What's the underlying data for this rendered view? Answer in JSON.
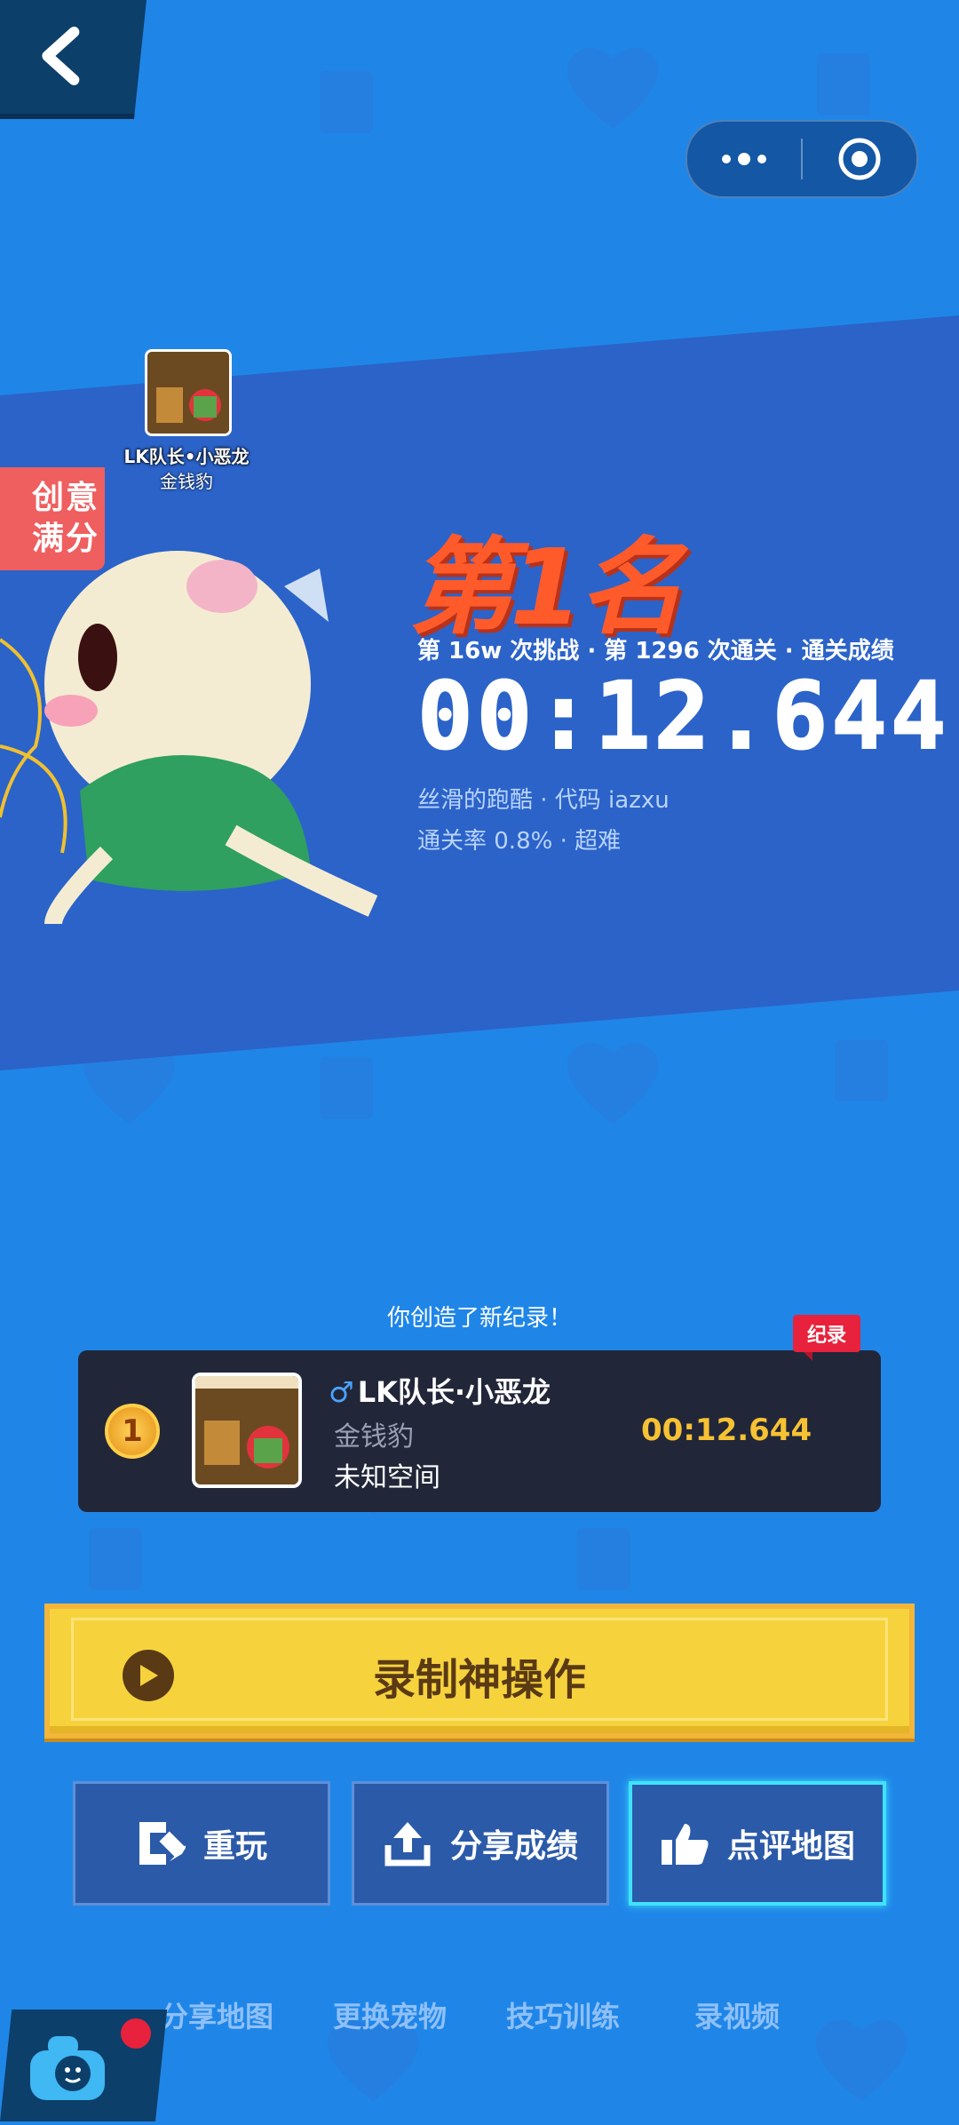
{
  "header": {
    "back_icon": "chevron-left-icon",
    "capsule": {
      "more_icon": "more-dots-icon",
      "close_icon": "target-close-icon"
    }
  },
  "creator": {
    "name": "LK队长•小恶龙",
    "pet": "金钱豹",
    "badge": "创意满分"
  },
  "result": {
    "rank_title": "第1名",
    "challenge_line": "第 16w 次挑战 · 第 1296 次通关 · 通关成绩",
    "time": "00:12.644",
    "map_line": "丝滑的跑酷 · 代码 iazxu",
    "rate_line": "通关率 0.8% · 超难"
  },
  "record": {
    "headline": "你创造了新纪录！",
    "tag": "纪录",
    "rank": "1",
    "gender_symbol": "♂",
    "player": "LK队长·小恶龙",
    "pet": "金钱豹",
    "space": "未知空间",
    "time": "00:12.644"
  },
  "actions": {
    "main": "录制神操作",
    "replay": "重玩",
    "share": "分享成绩",
    "review": "点评地图"
  },
  "bottom_links": [
    "分享地图",
    "更换宠物",
    "技巧训练",
    "录视频"
  ],
  "colors": {
    "background": "#1f86e8",
    "banner": "#2b63c9",
    "accent_yellow": "#f6d33d",
    "rank_red": "#ff5a2a",
    "record_time": "#f6c233",
    "review_glow": "#40e2ff"
  }
}
